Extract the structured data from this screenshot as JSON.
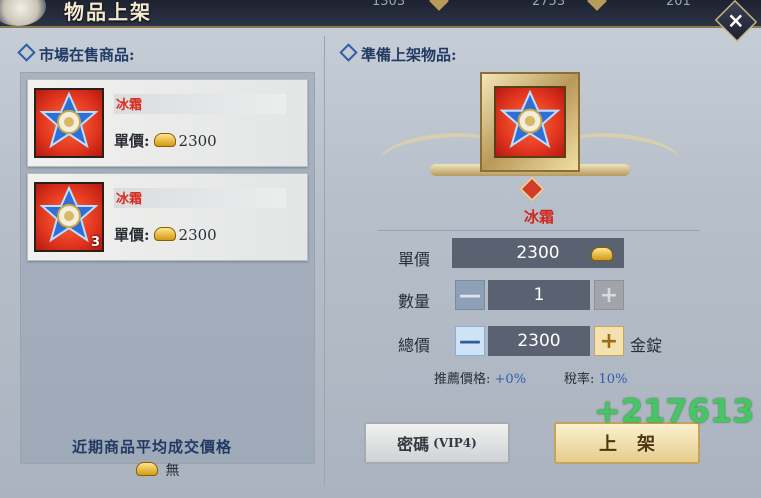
{
  "window": {
    "title": "物品上架",
    "top_stats": [
      "1303",
      "2753",
      "201"
    ],
    "close_label": "×"
  },
  "left": {
    "section_label": "市場在售商品:",
    "items": [
      {
        "name": "冰霜",
        "price_label": "單價:",
        "price": "2300",
        "quantity": ""
      },
      {
        "name": "冰霜",
        "price_label": "單價:",
        "price": "2300",
        "quantity": "3"
      }
    ],
    "avg_label": "近期商品平均成交價格",
    "avg_value": "無"
  },
  "right": {
    "section_label": "準備上架物品:",
    "selected_item": "冰霜",
    "unit_price_label": "單價",
    "unit_price": "2300",
    "quantity_label": "數量",
    "quantity": "1",
    "total_label": "總價",
    "total": "2300",
    "currency": "金錠",
    "recommended_label": "推薦價格:",
    "recommended_value": "+0%",
    "tax_label": "稅率:",
    "tax_value": "10%",
    "password_button": "密碼",
    "password_suffix": "(VIP4)",
    "list_button": "上架"
  },
  "overlay": {
    "floating_number": "+217613"
  },
  "icons": {
    "item": "ice-frost-star-icon",
    "currency": "gold-ingot-icon"
  },
  "colors": {
    "item_name": "#d0281c",
    "accent_blue": "#2d60a8",
    "float_green": "#35c853"
  }
}
